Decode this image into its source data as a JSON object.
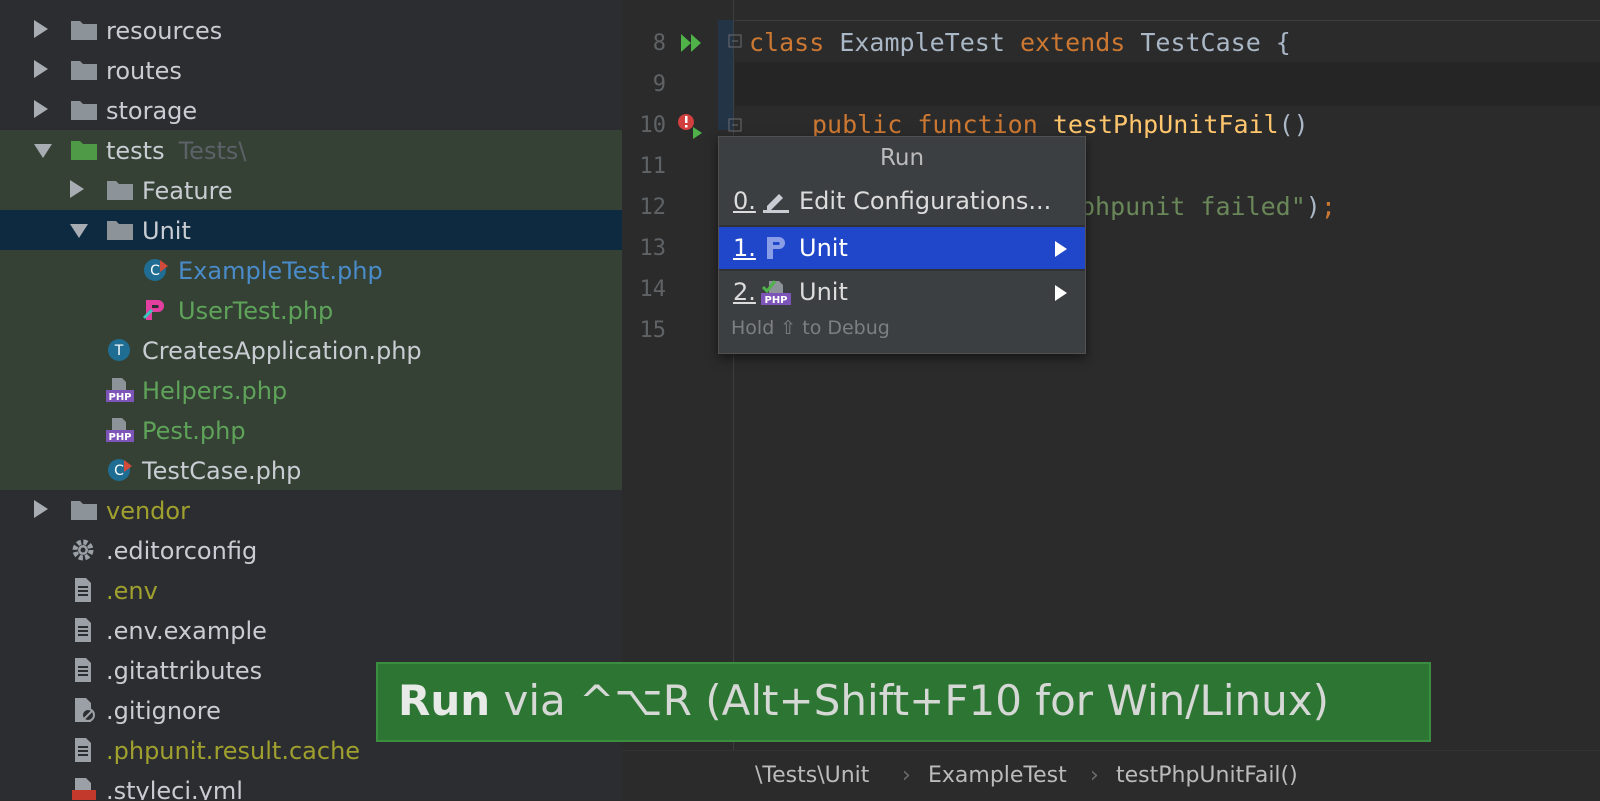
{
  "tree": {
    "items": [
      {
        "label": "resources"
      },
      {
        "label": "routes"
      },
      {
        "label": "storage"
      },
      {
        "label": "tests",
        "sublabel": "Tests\\"
      },
      {
        "label": "Feature"
      },
      {
        "label": "Unit"
      },
      {
        "label": "ExampleTest.php"
      },
      {
        "label": "UserTest.php"
      },
      {
        "label": "CreatesApplication.php"
      },
      {
        "label": "Helpers.php"
      },
      {
        "label": "Pest.php"
      },
      {
        "label": "TestCase.php"
      },
      {
        "label": "vendor"
      },
      {
        "label": ".editorconfig"
      },
      {
        "label": ".env"
      },
      {
        "label": ".env.example"
      },
      {
        "label": ".gitattributes"
      },
      {
        "label": ".gitignore"
      },
      {
        "label": ".phpunit.result.cache"
      },
      {
        "label": ".styleci.yml"
      }
    ]
  },
  "editor": {
    "line_numbers": [
      "8",
      "9",
      "10",
      "11",
      "12",
      "13",
      "14",
      "15"
    ],
    "code": {
      "l8_kw1": "class",
      "l8_name": " ExampleTest ",
      "l8_kw2": "extends",
      "l8_rest": " TestCase {",
      "l10_kw": "public function ",
      "l10_fn": "testPhpUnitFail",
      "l10_rest": "()",
      "l12_str": "phpunit failed\"",
      "l12_rest": ")",
      "l12_semi": ";"
    }
  },
  "popup": {
    "title": "Run",
    "items": [
      {
        "num": "0.",
        "label": "Edit Configurations...",
        "icon": "pencil-icon"
      },
      {
        "num": "1.",
        "label": "Unit",
        "icon": "pest-icon"
      },
      {
        "num": "2.",
        "label": "Unit",
        "icon": "phpunit-icon"
      }
    ],
    "hint": "Hold ⇧ to Debug"
  },
  "banner": {
    "bold": "Run",
    "text": " via ^⌥R (Alt+Shift+F10 for Win/Linux)"
  },
  "breadcrumb": {
    "items": [
      "\\Tests\\Unit",
      "ExampleTest",
      "testPhpUnitFail()"
    ],
    "separator": "›"
  },
  "colors": {
    "accent_selection": "#2046c9",
    "banner_green": "#2d7533",
    "tree_highlight": "#344134",
    "keyword": "#cc7832",
    "function": "#ffc66d",
    "string": "#6a8759"
  }
}
